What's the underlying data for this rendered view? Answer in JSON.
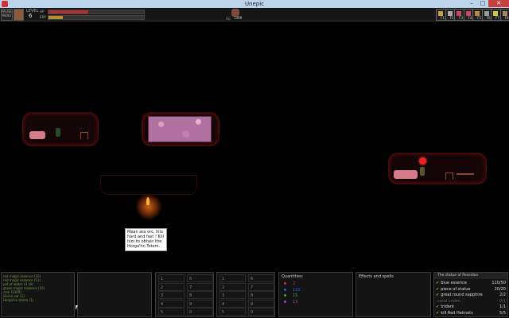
{
  "window": {
    "title": "Unepic",
    "min": "–",
    "max": "□",
    "close": "✕"
  },
  "hud": {
    "menu_label": "PAUSE MENU",
    "level_label": "LEVEL",
    "level": "6",
    "hp_label": "HP",
    "xp_label": "EXP",
    "hp_fill": 0.42,
    "xp_fill": 0.15,
    "gold_label": "AG",
    "gold": "1369",
    "hotkeys": [
      {
        "label": "F1",
        "icon": "key-icon"
      },
      {
        "label": "F2",
        "icon": "sword-icon"
      },
      {
        "label": "F3",
        "icon": "wand-icon"
      },
      {
        "label": "F4",
        "icon": "wand-icon"
      },
      {
        "label": "F5",
        "icon": "bow-icon"
      },
      {
        "label": "F6",
        "icon": "gear-icon"
      },
      {
        "label": "F7",
        "icon": "orb-icon"
      },
      {
        "label": "F8",
        "icon": "book-icon"
      }
    ]
  },
  "tooltip": "Mean ass orc, hits hard and fast ! Kill him to obtain the Horga'hn Totem.",
  "log": [
    "red magic essence (10)",
    "red magic essence (11)",
    "pot of water x2 (9)",
    "green magic essence (10)",
    "coin (1369)",
    "divine ear (1)",
    "Horga'hn totem (1)"
  ],
  "grid1": [
    "1",
    "2",
    "3",
    "4",
    "5",
    "6",
    "7",
    "8",
    "9",
    "0"
  ],
  "grid2": [
    "1",
    "2",
    "3",
    "4",
    "5",
    "6",
    "7",
    "8",
    "9",
    "0"
  ],
  "quantities": {
    "title": "Quantities:",
    "rows": [
      {
        "color": "#d03030",
        "value": "2"
      },
      {
        "color": "#3060d0",
        "value": "110"
      },
      {
        "color": "#30b030",
        "value": "15"
      },
      {
        "color": "#a040c0",
        "value": "13"
      }
    ]
  },
  "effects": {
    "title": "Effects and spells"
  },
  "quest": {
    "title": "The statue of Poseidon",
    "items": [
      {
        "name": "blue essence",
        "progress": "110/50",
        "done": true
      },
      {
        "name": "piece of statue",
        "progress": "20/20",
        "done": true
      },
      {
        "name": "great round sapphire",
        "progress": "2/2",
        "done": true
      },
      {
        "name": "coral crown",
        "progress": "0/1",
        "done": false
      },
      {
        "name": "trident",
        "progress": "1/1",
        "done": true
      },
      {
        "name": "kill Red Helmets",
        "progress": "5/5",
        "done": true
      }
    ]
  }
}
